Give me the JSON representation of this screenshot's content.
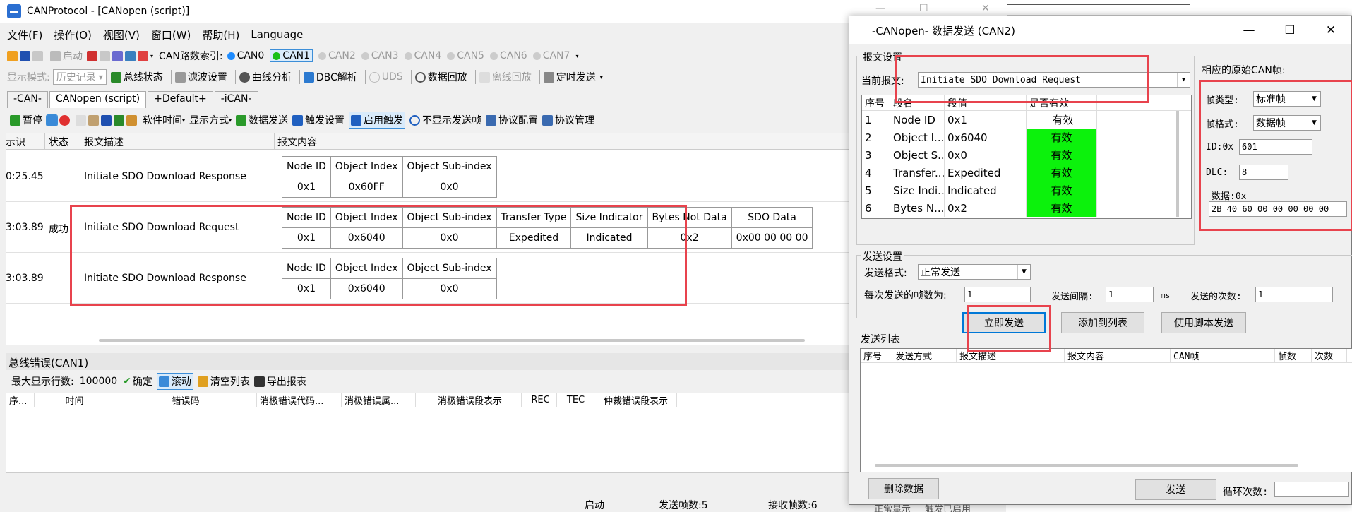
{
  "app": {
    "title": "CANProtocol - [CANopen (script)]"
  },
  "menu": [
    "文件(F)",
    "操作(O)",
    "视图(V)",
    "窗口(W)",
    "帮助(H)",
    "Language"
  ],
  "toolbar1": {
    "start": "启动",
    "can_index_label": "CAN路数索引:",
    "channels": [
      "CAN0",
      "CAN1",
      "CAN2",
      "CAN3",
      "CAN4",
      "CAN5",
      "CAN6",
      "CAN7"
    ]
  },
  "toolbar2": {
    "mode_label": "显示模式:",
    "mode_value": "历史记录",
    "bus_status": "总线状态",
    "filter": "滤波设置",
    "curve": "曲线分析",
    "dbc": "DBC解析",
    "uds": "UDS",
    "replay": "数据回放",
    "offline": "离线回放",
    "timed": "定时发送"
  },
  "tabs": [
    "-CAN-",
    "CANopen (script)",
    "+Default+",
    "-iCAN-"
  ],
  "toolbar3": {
    "pause": "暂停",
    "soft_time": "软件时间",
    "display": "显示方式",
    "send": "数据发送",
    "trigger_set": "触发设置",
    "trigger_on": "启用触发",
    "hide_sent": "不显示发送帧",
    "protocol_cfg": "协议配置",
    "protocol_mgr": "协议管理"
  },
  "main_grid": {
    "headers": [
      "示识",
      "状态",
      "报文描述",
      "报文内容"
    ],
    "rows": [
      {
        "time": "0:25.45",
        "status": "",
        "desc": "Initiate SDO Download Response",
        "fields": [
          "Node ID",
          "Object Index",
          "Object Sub-index"
        ],
        "values": [
          "0x1",
          "0x60FF",
          "0x0"
        ]
      },
      {
        "time": "3:03.89",
        "status": "成功",
        "desc": "Initiate SDO Download Request",
        "fields": [
          "Node ID",
          "Object Index",
          "Object Sub-index",
          "Transfer Type",
          "Size Indicator",
          "Bytes Not Data",
          "SDO Data"
        ],
        "values": [
          "0x1",
          "0x6040",
          "0x0",
          "Expedited",
          "Indicated",
          "0x2",
          "0x00 00 00 00"
        ]
      },
      {
        "time": "3:03.89",
        "status": "",
        "desc": "Initiate SDO Download Response",
        "fields": [
          "Node ID",
          "Object Index",
          "Object Sub-index"
        ],
        "values": [
          "0x1",
          "0x6040",
          "0x0"
        ]
      }
    ]
  },
  "error_pane": {
    "title": "总线错误(CAN1)",
    "max_rows_label": "最大显示行数:",
    "max_rows_value": "100000",
    "confirm": "确定",
    "scroll": "滚动",
    "clear": "清空列表",
    "export": "导出报表",
    "columns": [
      "序...",
      "时间",
      "错误码",
      "消极错误代码...",
      "消极错误属...",
      "消极错误段表示",
      "REC",
      "TEC",
      "仲裁错误段表示"
    ]
  },
  "statusbar": {
    "start": "启动",
    "sent": "发送帧数:5",
    "recv": "接收帧数:6",
    "right1": "正常显示",
    "right2": "触发已启用"
  },
  "dialog": {
    "title": "-CANopen- 数据发送 (CAN2)",
    "msg_group": "报文设置",
    "current_label": "当前报文:",
    "current_value": "Initiate SDO Download Request",
    "field_headers": [
      "序号",
      "段名",
      "段值",
      "是否有效"
    ],
    "fields": [
      {
        "no": "1",
        "name": "Node ID",
        "value": "0x1",
        "valid": "有效",
        "green": false
      },
      {
        "no": "2",
        "name": "Object I...",
        "value": "0x6040",
        "valid": "有效",
        "green": true
      },
      {
        "no": "3",
        "name": "Object S...",
        "value": "0x0",
        "valid": "有效",
        "green": true
      },
      {
        "no": "4",
        "name": "Transfer...",
        "value": "Expedited",
        "valid": "有效",
        "green": true
      },
      {
        "no": "5",
        "name": "Size Indi...",
        "value": "Indicated",
        "valid": "有效",
        "green": true
      },
      {
        "no": "6",
        "name": "Bytes N...",
        "value": "0x2",
        "valid": "有效",
        "green": true
      }
    ],
    "raw_group": "相应的原始CAN帧:",
    "frame_type_label": "帧类型:",
    "frame_type": "标准帧",
    "frame_format_label": "帧格式:",
    "frame_format": "数据帧",
    "id_label": "ID:0x",
    "id_value": "601",
    "dlc_label": "DLC:",
    "dlc_value": "8",
    "data_label": "数据:0x",
    "data_value": "2B 40 60 00 00 00 00 00",
    "send_group": "发送设置",
    "send_format_label": "发送格式:",
    "send_format": "正常发送",
    "frames_per_label": "每次发送的帧数为:",
    "frames_per_value": "1",
    "interval_label": "发送间隔:",
    "interval_value": "1",
    "interval_unit": "ms",
    "count_label": "发送的次数:",
    "count_value": "1",
    "btn_send_now": "立即发送",
    "btn_add_list": "添加到列表",
    "btn_script": "使用脚本发送",
    "list_label": "发送列表",
    "list_headers": [
      "序号",
      "发送方式",
      "报文描述",
      "报文内容",
      "CAN帧",
      "帧数",
      "次数"
    ],
    "btn_delete": "删除数据",
    "btn_send": "发送",
    "loop_label": "循环次数:"
  }
}
